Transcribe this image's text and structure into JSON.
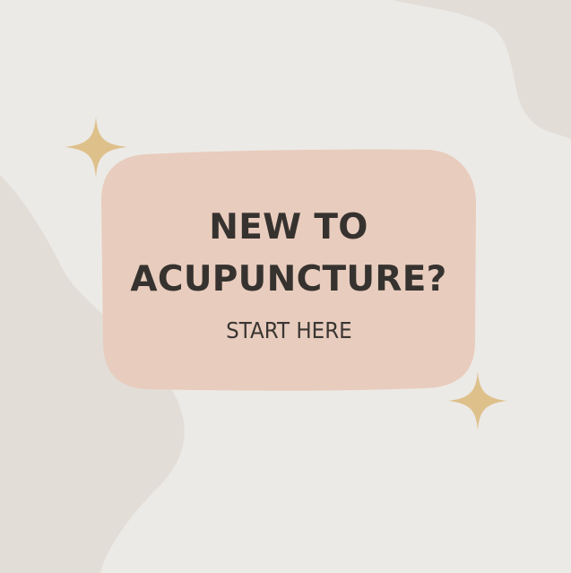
{
  "headline": {
    "line1": "NEW TO",
    "line2": "ACUPUNCTURE?"
  },
  "subline": "START HERE",
  "colors": {
    "background": "#ECEAE6",
    "blob": "#E3DDD8",
    "card": "#E8CCBD",
    "sparkle": "#DEC08B",
    "text": "#36322F"
  },
  "icons": [
    "sparkle-icon",
    "sparkle-icon"
  ]
}
